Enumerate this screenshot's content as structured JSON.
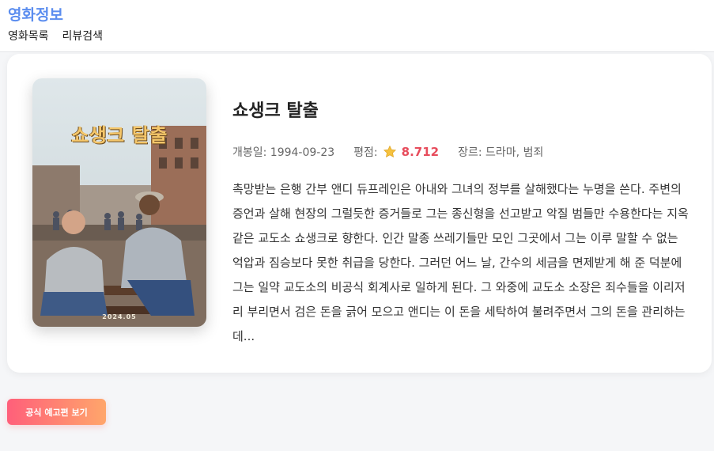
{
  "header": {
    "brand": "영화정보",
    "nav": [
      {
        "label": "영화목록"
      },
      {
        "label": "리뷰검색"
      }
    ]
  },
  "movie": {
    "title": "쇼생크 탈출",
    "poster": {
      "title_text": "쇼생크 탈출",
      "date_text": "2024.05"
    },
    "release_label": "개봉일: 1994-09-23",
    "rating_label": "평점:",
    "rating_value": "8.712",
    "genre_label": "장르: 드라마, 범죄",
    "overview": "촉망받는 은행 간부 앤디 듀프레인은 아내와 그녀의 정부를 살해했다는 누명을 쓴다. 주변의 증언과 살해 현장의 그럴듯한 증거들로 그는 종신형을 선고받고 악질 범들만 수용한다는 지옥같은 교도소 쇼생크로 향한다. 인간 말종 쓰레기들만 모인 그곳에서 그는 이루 말할 수 없는 억압과 짐승보다 못한 취급을 당한다. 그러던 어느 날, 간수의 세금을 면제받게 해 준 덕분에 그는 일약 교도소의 비공식 회계사로 일하게 된다. 그 와중에 교도소 소장은 죄수들을 이리저리 부리면서 검은 돈을 긁어 모으고 앤디는 이 돈을 세탁하여 불려주면서 그의 돈을 관리하는데..."
  },
  "actions": {
    "trailer_label": "공식 예고편 보기"
  },
  "colors": {
    "brand": "#5b8def",
    "rating": "#e74c5c",
    "button_start": "#ff5f7a",
    "button_end": "#ffa66b"
  },
  "icons": {
    "rating": "star-icon"
  }
}
